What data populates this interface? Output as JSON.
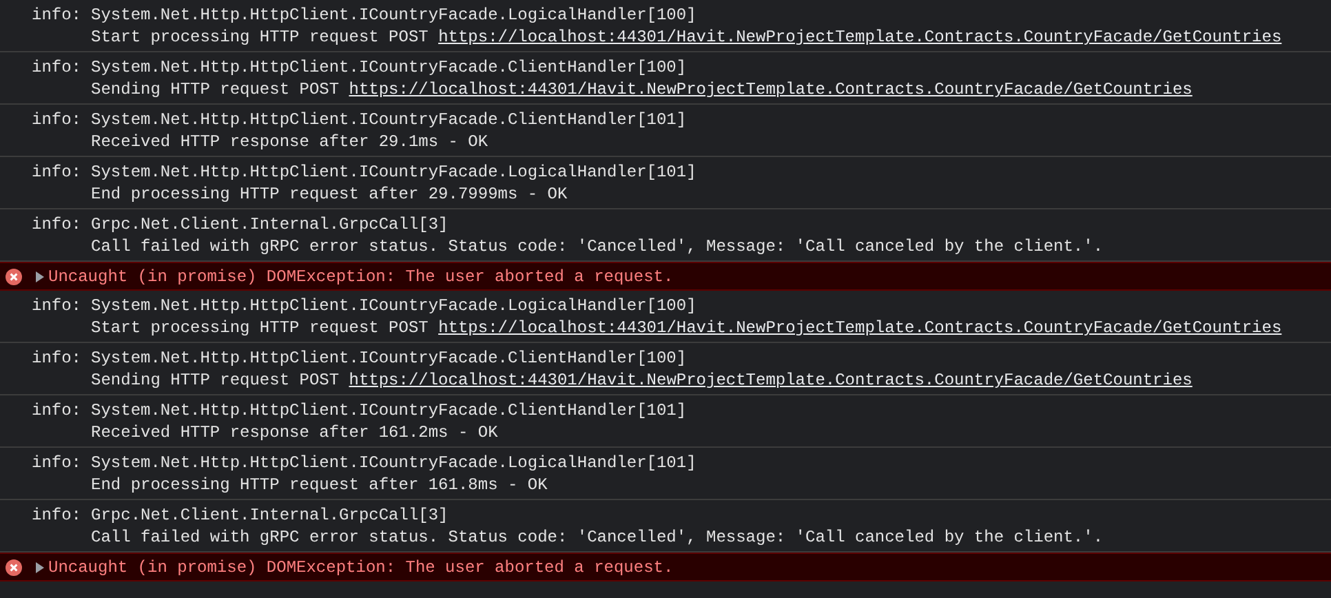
{
  "console": [
    {
      "kind": "info",
      "prefix": "info:",
      "source": "System.Net.Http.HttpClient.ICountryFacade.LogicalHandler[100]",
      "message": "Start processing HTTP request POST ",
      "link": "https://localhost:44301/Havit.NewProjectTemplate.Contracts.CountryFacade/GetCountries"
    },
    {
      "kind": "info",
      "prefix": "info:",
      "source": "System.Net.Http.HttpClient.ICountryFacade.ClientHandler[100]",
      "message": "Sending HTTP request POST ",
      "link": "https://localhost:44301/Havit.NewProjectTemplate.Contracts.CountryFacade/GetCountries"
    },
    {
      "kind": "info",
      "prefix": "info:",
      "source": "System.Net.Http.HttpClient.ICountryFacade.ClientHandler[101]",
      "message": "Received HTTP response after 29.1ms - OK"
    },
    {
      "kind": "info",
      "prefix": "info:",
      "source": "System.Net.Http.HttpClient.ICountryFacade.LogicalHandler[101]",
      "message": "End processing HTTP request after 29.7999ms - OK"
    },
    {
      "kind": "info",
      "prefix": "info:",
      "source": "Grpc.Net.Client.Internal.GrpcCall[3]",
      "message": "Call failed with gRPC error status. Status code: 'Cancelled', Message: 'Call canceled by the client.'."
    },
    {
      "kind": "error",
      "expanded": false,
      "message": "Uncaught (in promise) DOMException: The user aborted a request."
    },
    {
      "kind": "info",
      "prefix": "info:",
      "source": "System.Net.Http.HttpClient.ICountryFacade.LogicalHandler[100]",
      "message": "Start processing HTTP request POST ",
      "link": "https://localhost:44301/Havit.NewProjectTemplate.Contracts.CountryFacade/GetCountries"
    },
    {
      "kind": "info",
      "prefix": "info:",
      "source": "System.Net.Http.HttpClient.ICountryFacade.ClientHandler[100]",
      "message": "Sending HTTP request POST ",
      "link": "https://localhost:44301/Havit.NewProjectTemplate.Contracts.CountryFacade/GetCountries"
    },
    {
      "kind": "info",
      "prefix": "info:",
      "source": "System.Net.Http.HttpClient.ICountryFacade.ClientHandler[101]",
      "message": "Received HTTP response after 161.2ms - OK"
    },
    {
      "kind": "info",
      "prefix": "info:",
      "source": "System.Net.Http.HttpClient.ICountryFacade.LogicalHandler[101]",
      "message": "End processing HTTP request after 161.8ms - OK"
    },
    {
      "kind": "info",
      "prefix": "info:",
      "source": "Grpc.Net.Client.Internal.GrpcCall[3]",
      "message": "Call failed with gRPC error status. Status code: 'Cancelled', Message: 'Call canceled by the client.'."
    },
    {
      "kind": "error",
      "expanded": false,
      "message": "Uncaught (in promise) DOMException: The user aborted a request."
    }
  ]
}
